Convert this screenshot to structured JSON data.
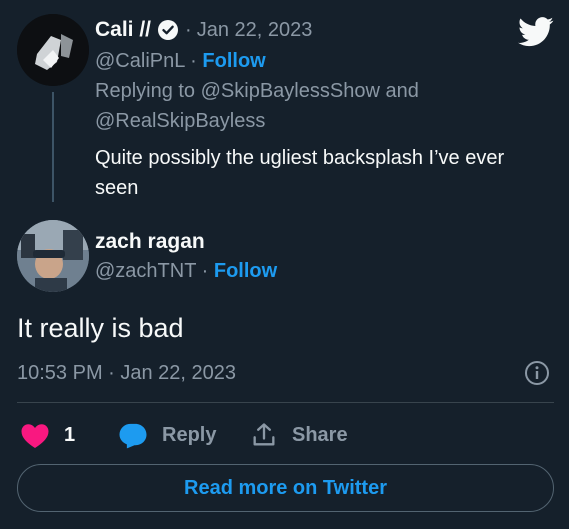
{
  "reply": {
    "author": {
      "name": "Cali //",
      "handle": "@CaliPnL",
      "date": "Jan 22, 2023",
      "follow_label": "Follow"
    },
    "replying_prefix": "Replying to",
    "replying_to": [
      "@SkipBaylessShow",
      "@RealSkipBayless"
    ],
    "replying_and": "and",
    "text_line1": "Quite possibly the ugliest backsplash I’ve ever",
    "text_line2": "seen"
  },
  "tweet": {
    "author": {
      "name": "zach ragan",
      "handle": "@zachTNT",
      "follow_label": "Follow"
    },
    "text": "It really is bad",
    "timestamp": "10:53 PM · Jan 22, 2023"
  },
  "actions": {
    "like_count": "1",
    "reply_label": "Reply",
    "share_label": "Share"
  },
  "read_more_label": "Read more on Twitter",
  "separator": "·",
  "colors": {
    "background": "#15202b",
    "accent": "#1d9bf0",
    "like": "#f91880",
    "muted": "#8b98a5"
  }
}
